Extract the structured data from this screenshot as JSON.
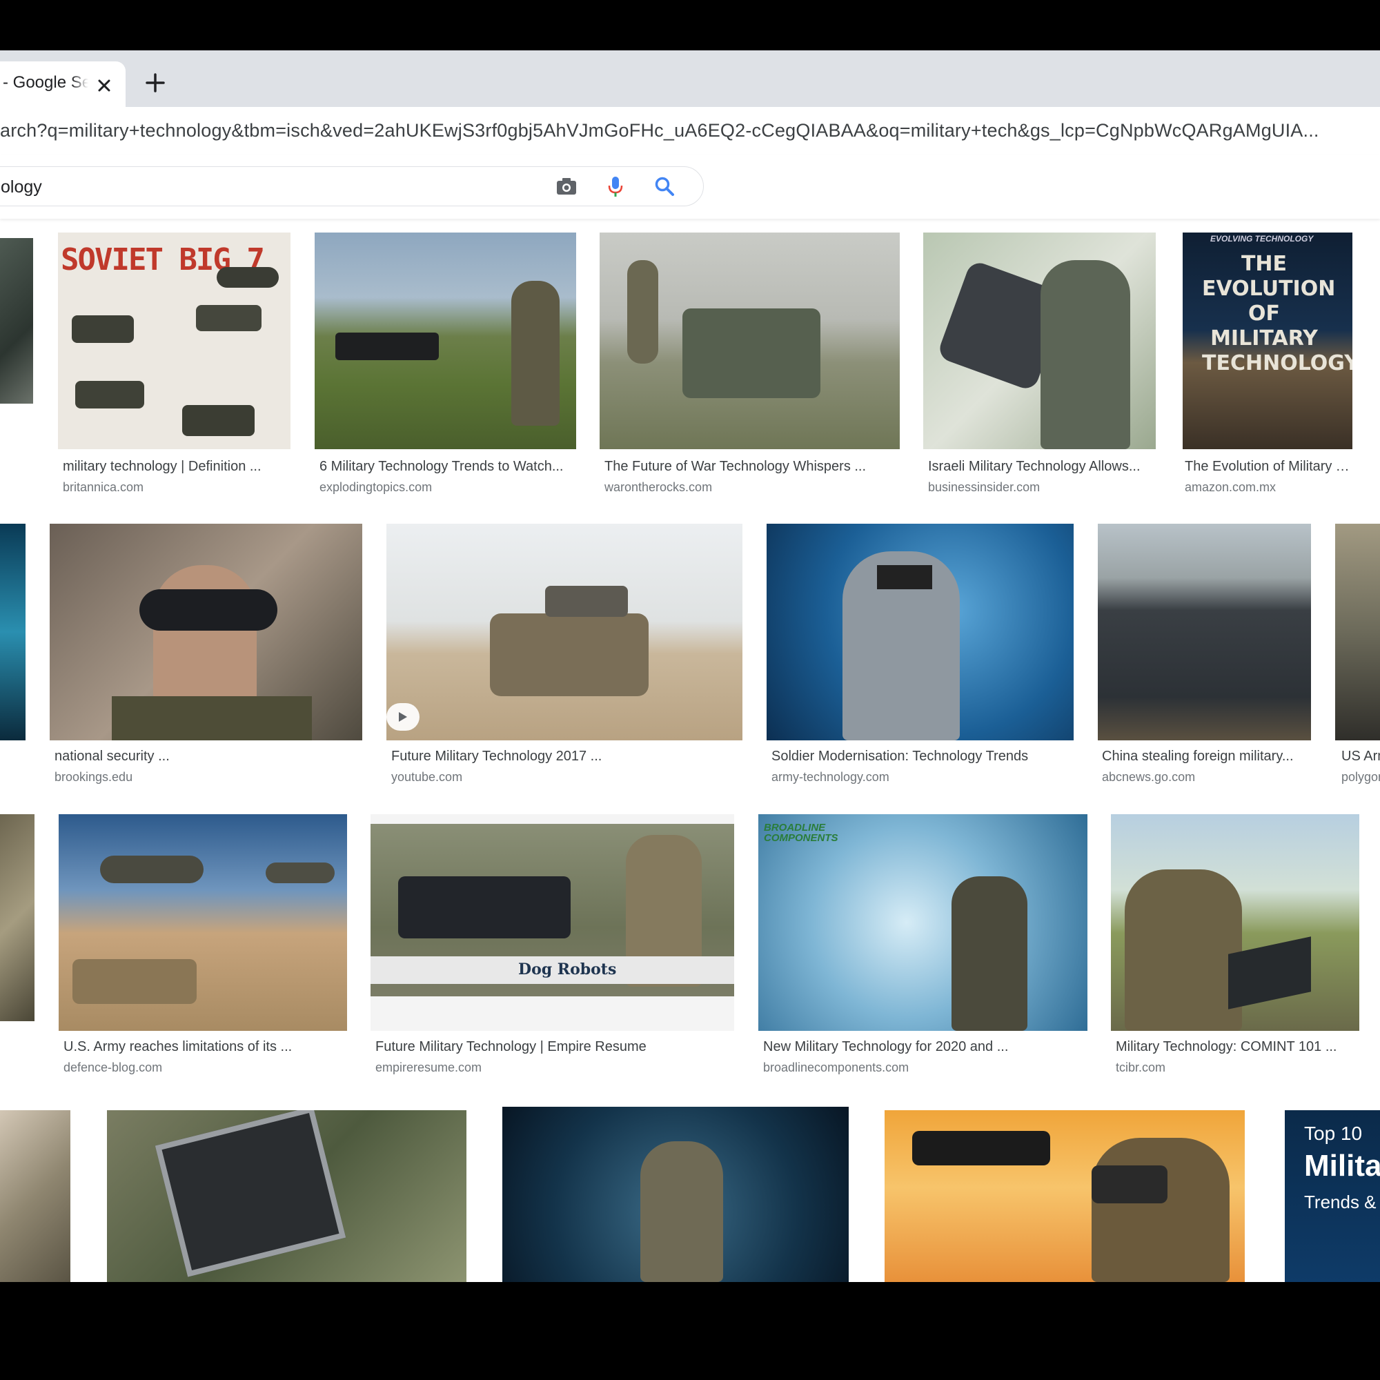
{
  "tab": {
    "title": "- Google Search",
    "close_icon": "close-icon",
    "new_tab_icon": "plus-icon"
  },
  "address_bar": {
    "url": "arch?q=military+technology&tbm=isch&ved=2ahUKEwjS3rf0gbj5AhVJmGoFHc_uA6EQ2-cCegQIABAA&oq=military+tech&gs_lcp=CgNpbWcQARgAMgUIA..."
  },
  "search": {
    "query": "ology",
    "icons": [
      "camera-icon",
      "mic-icon",
      "search-icon"
    ]
  },
  "colors": {
    "tabstrip": "#dee1e6",
    "caption": "#3c4043",
    "source": "#70757a",
    "search_blue": "#4285f4",
    "mic_red": "#ea4335"
  },
  "results": [
    {
      "caption": "military technology | Definition ...",
      "source": "britannica.com",
      "thumb_text": "SOVIET BIG 7"
    },
    {
      "caption": "6 Military Technology Trends to Watch...",
      "source": "explodingtopics.com"
    },
    {
      "caption": "The Future of War Technology Whispers ...",
      "source": "warontherocks.com"
    },
    {
      "caption": "Israeli Military Technology Allows...",
      "source": "businessinsider.com"
    },
    {
      "caption": "The Evolution of Military Technology",
      "source": "amazon.com.mx",
      "thumb_text": "EVOLVING TECHNOLOGY",
      "thumb_title": "THE EVOLUTION OF MILITARY TECHNOLOGY"
    },
    {
      "caption": "national security ...",
      "source": "brookings.edu"
    },
    {
      "caption": "Future Military Technology 2017 ...",
      "source": "youtube.com"
    },
    {
      "caption": "Soldier Modernisation: Technology Trends",
      "source": "army-technology.com"
    },
    {
      "caption": "China stealing foreign military...",
      "source": "abcnews.go.com"
    },
    {
      "caption": "US Army",
      "source": "polygon.com"
    },
    {
      "caption": "U.S. Army reaches limitations of its ...",
      "source": "defence-blog.com"
    },
    {
      "caption": "Future Military Technology | Empire Resume",
      "source": "empireresume.com",
      "thumb_text": "Dog Robots"
    },
    {
      "caption": "New Military Technology for 2020 and ...",
      "source": "broadlinecomponents.com",
      "thumb_text": "BROADLINE COMPONENTS"
    },
    {
      "caption": "Military Technology: COMINT 101 ...",
      "source": "tcibr.com"
    },
    {
      "thumb_text": "Top 10",
      "thumb_title": "Milita",
      "thumb_sub": "Trends &"
    }
  ]
}
